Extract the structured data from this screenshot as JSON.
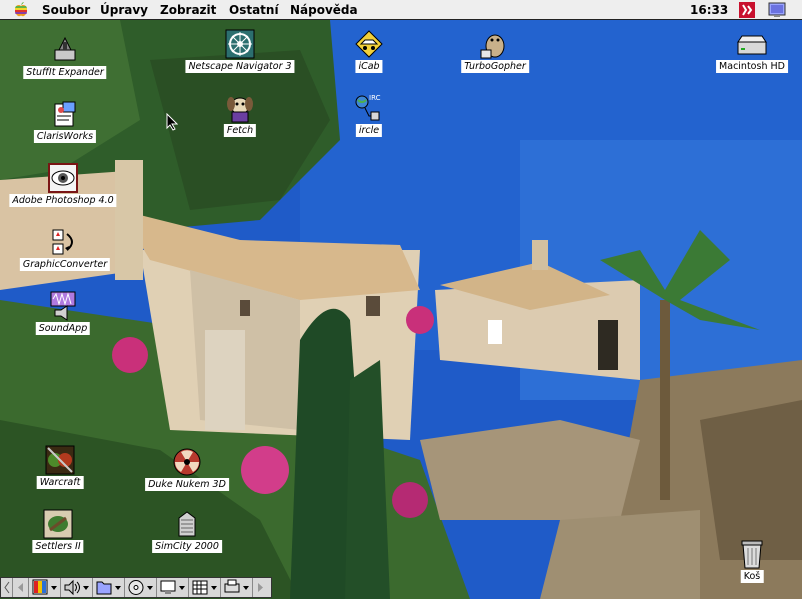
{
  "menubar": {
    "menus": [
      "Soubor",
      "Úpravy",
      "Zobrazit",
      "Ostatní",
      "Nápověda"
    ],
    "clock": "16:33"
  },
  "icons": [
    {
      "label": "StuffIt Expander",
      "icon": "stuffit-icon"
    },
    {
      "label": "ClarisWorks",
      "icon": "clarisworks-icon"
    },
    {
      "label": "Adobe Photoshop 4.0",
      "icon": "photoshop-icon"
    },
    {
      "label": "GraphicConverter",
      "icon": "graphicconverter-icon"
    },
    {
      "label": "SoundApp",
      "icon": "soundapp-icon"
    },
    {
      "label": "Warcraft",
      "icon": "warcraft-icon"
    },
    {
      "label": "Settlers II",
      "icon": "settlers-icon"
    },
    {
      "label": "Netscape Navigator 3",
      "icon": "netscape-icon"
    },
    {
      "label": "Fetch",
      "icon": "fetch-dog-icon"
    },
    {
      "label": "iCab",
      "icon": "icab-icon"
    },
    {
      "label": "ircle",
      "icon": "ircle-icon"
    },
    {
      "label": "TurboGopher",
      "icon": "turbogopher-icon"
    },
    {
      "label": "Duke Nukem 3D",
      "icon": "duke-nukem-radiation-icon"
    },
    {
      "label": "SimCity 2000",
      "icon": "simcity-building-icon"
    },
    {
      "label": "Macintosh HD",
      "icon": "hard-disk-icon"
    },
    {
      "label": "Koš",
      "icon": "trash-icon"
    }
  ],
  "ircle_badge": "IRC",
  "colors": {
    "sea": "#1d55c4",
    "sky_sea_light": "#2f72d8",
    "menubar": "#eeeeee",
    "label_bg": "#ffffff"
  }
}
